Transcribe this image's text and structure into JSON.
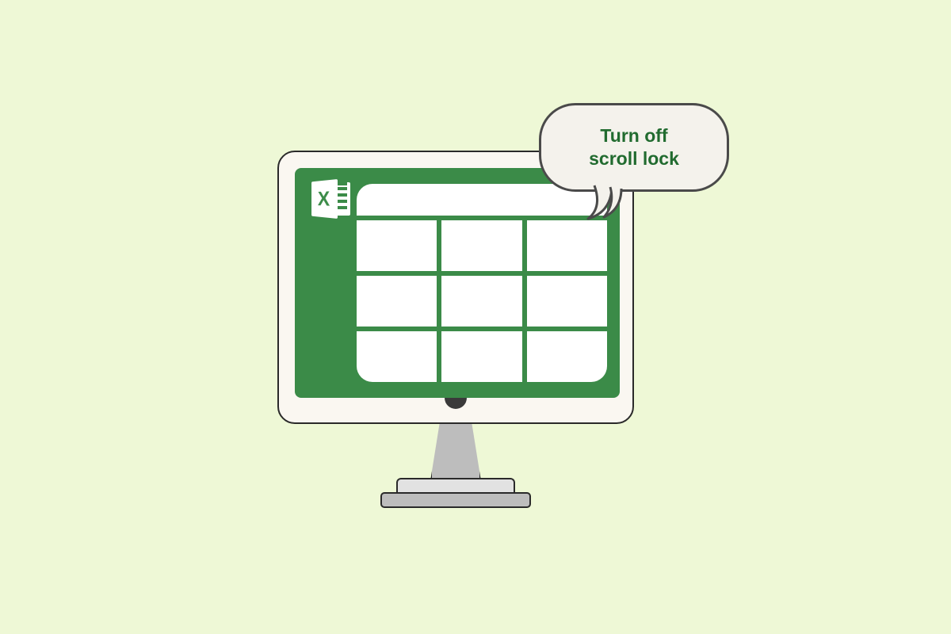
{
  "colors": {
    "background": "#eef8d6",
    "excel_green": "#3b8b48",
    "bubble_fill": "#f4f2ec",
    "bubble_text": "#216b2f",
    "outline": "#2a2a2a"
  },
  "excel_icon": {
    "letter": "X"
  },
  "speech_bubble": {
    "text": "Turn off\nscroll lock"
  }
}
